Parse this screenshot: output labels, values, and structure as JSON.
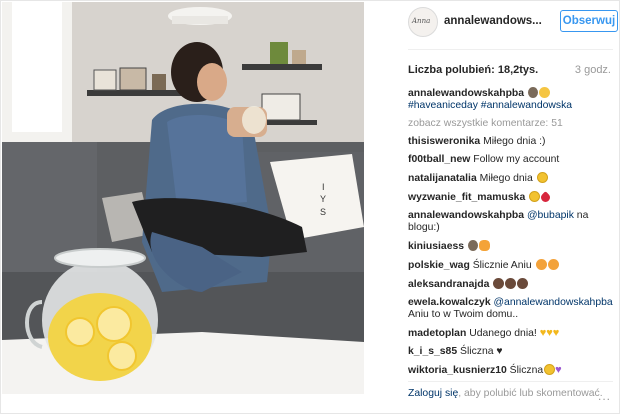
{
  "post": {
    "username": "annalewandows...",
    "follow_label": "Obserwuj",
    "avatar_text": "Anna",
    "likes_label": "Liczba polubień:",
    "likes_value": "18,2tys.",
    "time": "3 godz."
  },
  "caption": {
    "user": "annalewandowskahpba",
    "hashtags": "#haveaniceday #annalewandowska"
  },
  "view_all": "zobacz wszystkie komentarze: 51",
  "comments": [
    {
      "user": "thisisweronika",
      "text": "Miłego dnia :)"
    },
    {
      "user": "f00tball_new",
      "text": "Follow my account"
    },
    {
      "user": "natalijanatalia",
      "text": "Miłego dnia"
    },
    {
      "user": "wyzwanie_fit_mamuska",
      "text": ""
    },
    {
      "user": "annalewandowskahpba",
      "mention": "@bubapik",
      "text": " na blogu:)"
    },
    {
      "user": "kiniusiaess",
      "text": ""
    },
    {
      "user": "polskie_wag",
      "text": "Ślicznie Aniu"
    },
    {
      "user": "aleksandranajda",
      "text": ""
    },
    {
      "user": "ewela.kowalczyk",
      "mention": "@annalewandowskahpba",
      "text": " Aniu to w Twoim domu.."
    },
    {
      "user": "madetoplan",
      "text": "Udanego dnia!"
    },
    {
      "user": "k_i_s_s85",
      "text": "Śliczna ♥"
    },
    {
      "user": "wiktoria_kusnierz10",
      "text": "Śliczna"
    }
  ],
  "footer": {
    "login": "Zaloguj się",
    "rest": ", aby polubić lub skomentować.",
    "more": "..."
  },
  "colors": {
    "accent": "#3897f0",
    "link": "#003569",
    "muted": "#999999"
  },
  "icons": [
    "ellipsis-icon"
  ]
}
